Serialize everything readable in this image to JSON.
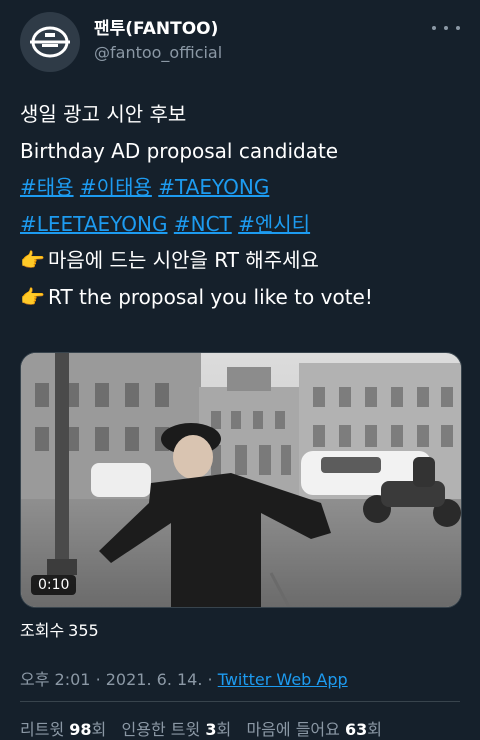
{
  "author": {
    "display_name": "팬투(FANTOO)",
    "handle": "@fantoo_official"
  },
  "tweet": {
    "lines": [
      "생일 광고 시안 후보",
      "Birthday AD proposal candidate"
    ],
    "hashtags": [
      "#태용",
      "#이태용",
      "#TAEYONG",
      "#LEETAEYONG",
      "#NCT",
      "#엔시티"
    ],
    "pointer_emoji": "👉",
    "call_to_action_ko": "마음에 드는 시안을 RT 해주세요",
    "call_to_action_en": "RT the proposal you like to vote!"
  },
  "media": {
    "duration": "0:10"
  },
  "views": {
    "label": "조회수",
    "count": "355"
  },
  "meta": {
    "time": "오후 2:01",
    "separator": "·",
    "date": "2021. 6. 14.",
    "source": "Twitter Web App"
  },
  "stats": {
    "retweets_label": "리트윗",
    "retweets_count": "98",
    "retweets_suffix": "회",
    "quotes_label": "인용한 트윗",
    "quotes_count": "3",
    "quotes_suffix": "회",
    "likes_label": "마음에 들어요",
    "likes_count": "63",
    "likes_suffix": "회"
  },
  "colors": {
    "background": "#15202b",
    "link": "#1d9bf0",
    "secondary_text": "#8b98a5"
  },
  "icons": {
    "avatar": "fantoo-logo-icon",
    "more": "more-options-icon"
  }
}
